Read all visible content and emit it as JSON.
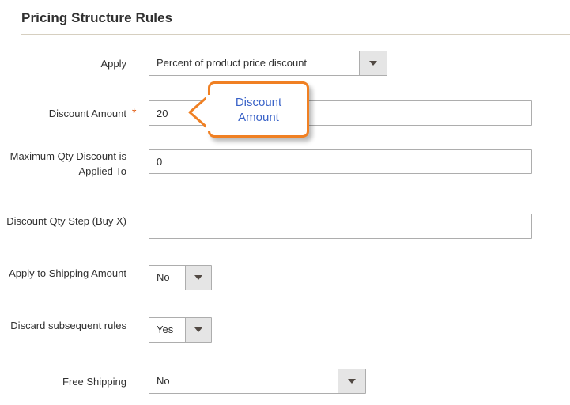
{
  "section": {
    "title": "Pricing Structure Rules"
  },
  "form": {
    "rows": [
      {
        "id": "apply",
        "label": "Apply",
        "control": "select",
        "value": "Percent of product price discount",
        "required": false
      },
      {
        "id": "discount-amount",
        "label": "Discount Amount",
        "control": "text",
        "value": "20",
        "required": true,
        "required_marker": "*"
      },
      {
        "id": "maximum-qty-discount-is-applied-to",
        "label": "Maximum Qty Discount is Applied To",
        "control": "text",
        "value": "0",
        "required": false
      },
      {
        "id": "discount-qty-step-buy-x",
        "label": "Discount Qty Step (Buy X)",
        "control": "text",
        "value": "",
        "required": false
      },
      {
        "id": "apply-to-shipping-amount",
        "label": "Apply to Shipping Amount",
        "control": "select",
        "value": "No",
        "required": false
      },
      {
        "id": "discard-subsequent-rules",
        "label": "Discard subsequent rules",
        "control": "select",
        "value": "Yes",
        "required": false
      },
      {
        "id": "free-shipping",
        "label": "Free Shipping",
        "control": "select",
        "value": "No",
        "required": false
      }
    ]
  },
  "callout": {
    "text": "Discount\nAmount",
    "border_color": "#f08023",
    "text_color": "#3a63c8"
  },
  "icons": {
    "caret": "chevron-down-icon"
  }
}
